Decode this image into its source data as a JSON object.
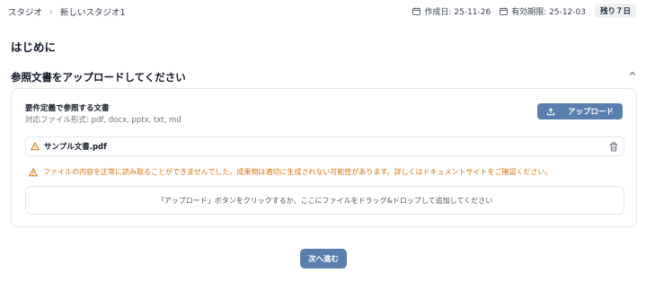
{
  "breadcrumb": {
    "root": "スタジオ",
    "current": "新しいスタジオ1"
  },
  "meta": {
    "created": "作成日: 25-11-26",
    "expires": "有効期限: 25-12-03",
    "remaining": "残り７日"
  },
  "page": {
    "title": "はじめに"
  },
  "section": {
    "title": "参照文書をアップロードしてください"
  },
  "card": {
    "doc_title": "要件定義で参照する文書",
    "formats": "対応ファイル形式: pdf, docx, pptx, txt, md",
    "upload_label": "アップロード",
    "file_name": "サンプル文書.pdf",
    "warning": "ファイルの内容を正常に読み取ることができませんでした。成果物は適切に生成されない可能性があります。詳しくはドキュメントサイトをご確認ください。",
    "dropzone": "「アップロード」ボタンをクリックするか、ここにファイルをドラッグ&ドロップして追加してください"
  },
  "footer": {
    "next_label": "次へ進む"
  },
  "colors": {
    "primary": "#5a7fae",
    "warning": "#d9730d",
    "border": "#e5e7eb"
  },
  "icons": [
    "calendar-icon",
    "chevron-up-icon",
    "upload-icon",
    "warning-icon",
    "trash-icon"
  ]
}
